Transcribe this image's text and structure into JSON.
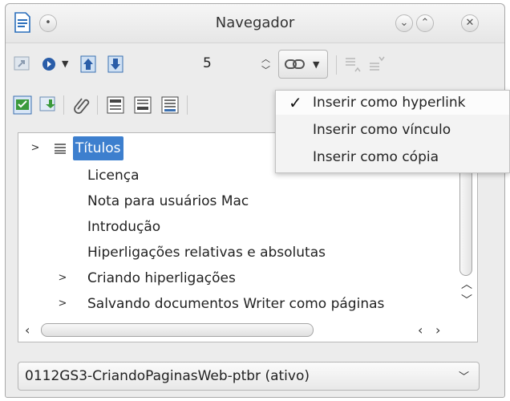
{
  "window": {
    "title": "Navegador"
  },
  "toolbar": {
    "page_number": "5"
  },
  "drag_menu": {
    "items": [
      {
        "label": "Inserir como hyperlink",
        "checked": true
      },
      {
        "label": "Inserir como vínculo",
        "checked": false
      },
      {
        "label": "Inserir como cópia",
        "checked": false
      }
    ]
  },
  "tree": {
    "items": [
      {
        "label": "Títulos",
        "level": 0,
        "expandable": true,
        "selected": true
      },
      {
        "label": "Licença",
        "level": 1,
        "expandable": false
      },
      {
        "label": "Nota para usuários Mac",
        "level": 1,
        "expandable": false
      },
      {
        "label": "Introdução",
        "level": 1,
        "expandable": false
      },
      {
        "label": "Hiperligações relativas e absolutas",
        "level": 1,
        "expandable": false
      },
      {
        "label": "Criando hiperligações",
        "level": 1,
        "expandable": true
      },
      {
        "label": "Salvando documentos Writer como páginas",
        "level": 1,
        "expandable": true
      }
    ]
  },
  "document_select": {
    "value": "0112GS3-CriandoPaginasWeb-ptbr (ativo)"
  },
  "colors": {
    "selection": "#3d7fce",
    "window_bg": "#ececec"
  }
}
